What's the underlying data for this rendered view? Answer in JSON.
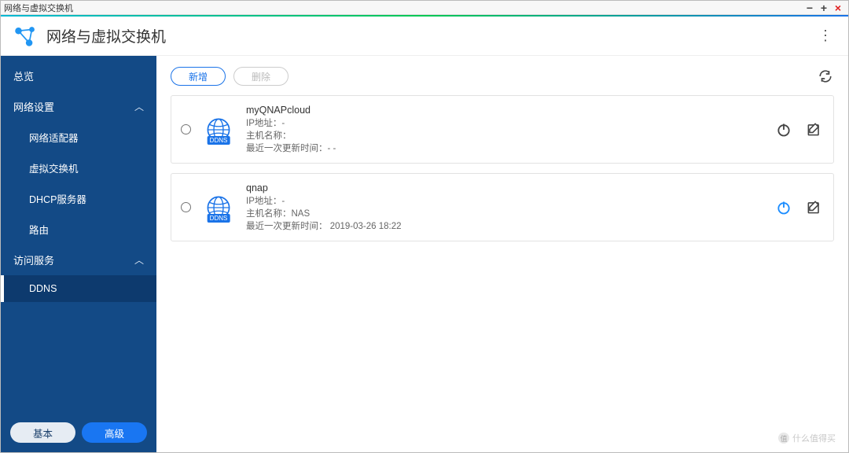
{
  "window": {
    "title": "网络与虚拟交换机"
  },
  "header": {
    "title": "网络与虚拟交换机"
  },
  "sidebar": {
    "items": [
      {
        "label": "总览",
        "type": "item"
      },
      {
        "label": "网络设置",
        "type": "group"
      },
      {
        "label": "网络适配器",
        "type": "child"
      },
      {
        "label": "虚拟交换机",
        "type": "child"
      },
      {
        "label": "DHCP服务器",
        "type": "child"
      },
      {
        "label": "路由",
        "type": "child"
      },
      {
        "label": "访问服务",
        "type": "group"
      },
      {
        "label": "DDNS",
        "type": "child",
        "selected": true
      }
    ],
    "footer": {
      "basic": "基本",
      "advanced": "高级"
    }
  },
  "toolbar": {
    "add": "新增",
    "delete": "删除"
  },
  "ddns_icon_label": "DDNS",
  "services": [
    {
      "name": "myQNAPcloud",
      "ip_label": "IP地址：-",
      "host_label": "主机名称：",
      "last_label": "最近一次更新时间：- -",
      "power_active": false
    },
    {
      "name": "qnap",
      "ip_label": "IP地址：-",
      "host_label": "主机名称：NAS",
      "last_label": "最近一次更新时间： 2019-03-26 18:22",
      "power_active": true
    }
  ],
  "watermark": {
    "text": "什么值得买"
  }
}
